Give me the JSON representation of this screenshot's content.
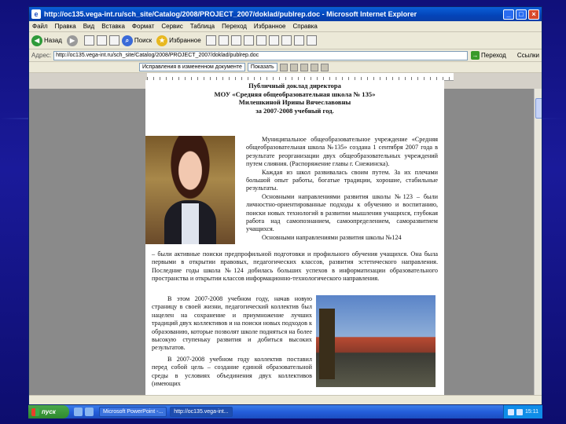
{
  "window": {
    "title": "http://oc135.vega-int.ru/sch_site/Catalog/2008/PROJECT_2007/doklad/publrep.doc - Microsoft Internet Explorer",
    "min_label": "_",
    "max_label": "□",
    "close_label": "×"
  },
  "menu": [
    "Файл",
    "Правка",
    "Вид",
    "Вставка",
    "Формат",
    "Сервис",
    "Таблица",
    "Переход",
    "Избранное",
    "Справка"
  ],
  "toolbar": {
    "back_label": "Назад",
    "search_label": "Поиск",
    "favorites_label": "Избранное"
  },
  "address": {
    "label": "Адрес:",
    "url": "http://oc135.vega-int.ru/sch_site/Catalog/2008/PROJECT_2007/doklad/publrep.doc",
    "go_label": "Переход",
    "links_label": "Ссылки"
  },
  "docbar": {
    "review_label": "Исправления в измененном документе",
    "show_label": "Показать"
  },
  "document": {
    "header": [
      "Публичный доклад директора",
      "МОУ «Средняя общеобразовательная школа № 135»",
      "Милешкиной Ирины Вячеславовны",
      "за 2007-2008 учебный год."
    ],
    "p1": "Муниципальное общеобразовательное учреждение «Средняя общеобразовательная школа №135» создана 1 сентября 2007 года в результате реорганизации двух общеобразовательных учреждений путем слияния. (Распоряжение главы г. Снежинска).",
    "p2": "Каждая из школ развивалась своим путем. За их плечами большой опыт работы, богатые традиции, хорошие, стабильные результаты.",
    "p3": "Основными направлениями развития школы №123 – были личностно-ориентированные подходы к обучению и воспитанию, поиски новых технологий в развитии мышления учащихся, глубокая работа над самопознанием, самоопределением, саморазвитием учащихся.",
    "p4a": "Основными направлениями развития школы №124",
    "p4b": "– были активные поиски предпрофильной подготовки и профильного обучения учащихся. Она была первыми в открытии правовых, педагогических классов, развития эстетического направления. Последние годы школа №124 добилась больших успехов в информатизации образовательного пространства и открытии классов информационно-технологического направления.",
    "p5": "В этом 2007-2008 учебном году, начав новую страницу в своей жизни, педагогический коллектив был нацелен на сохранение и приумножение лучших традиций двух коллективов и на поиски новых подходов к образованию, которые позволят школе подняться на более высокую ступеньку развития и добиться высоких результатов.",
    "p6": "В 2007-2008 учебном году коллектив поставил перед собой цель – создание единой образовательной среды в условиях объединения двух коллективов (имеющих"
  },
  "taskbar": {
    "start_label": "пуск",
    "tasks": [
      "Microsoft PowerPoint -...",
      "http://oc135.vega-int..."
    ],
    "clock": "15:11"
  },
  "colors": {
    "slide_bg": "#10107a",
    "title_bar": "#0a5fd8",
    "taskbar": "#245edb"
  }
}
